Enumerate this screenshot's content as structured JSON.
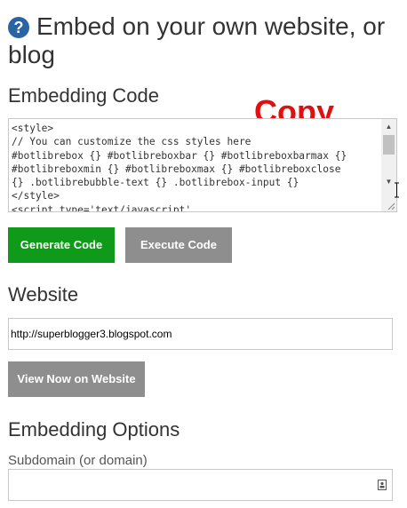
{
  "header": {
    "title": "Embed on your own website, or blog",
    "help_icon_glyph": "?"
  },
  "embedding_code": {
    "heading": "Embedding Code",
    "copy_label": "Copy",
    "code": "<style>\n// You can customize the css styles here\n#botlibrebox {} #botlibreboxbar {} #botlibreboxbarmax {}\n#botlibreboxmin {} #botlibreboxmax {} #botlibreboxclose\n{} .botlibrebubble-text {} .botlibrebox-input {}\n</style>\n<script type='text/javascript'",
    "generate_button": "Generate Code",
    "execute_button": "Execute Code"
  },
  "website": {
    "heading": "Website",
    "url_value": "http://superblogger3.blogspot.com",
    "view_button": "View Now on Website"
  },
  "embedding_options": {
    "heading": "Embedding Options",
    "subdomain_label": "Subdomain (or domain)",
    "subdomain_value": ""
  },
  "icons": {
    "help": "question-circle-icon",
    "scroll_up": "arrow-up-icon",
    "scroll_down": "arrow-down-icon",
    "resize": "resize-grip-icon",
    "cursor": "text-cursor-icon",
    "contact": "contact-card-icon"
  },
  "colors": {
    "accent_green": "#0f9a19",
    "button_gray": "#8e8e8e",
    "copy_red": "#e01010",
    "help_blue": "#2a64a4"
  }
}
